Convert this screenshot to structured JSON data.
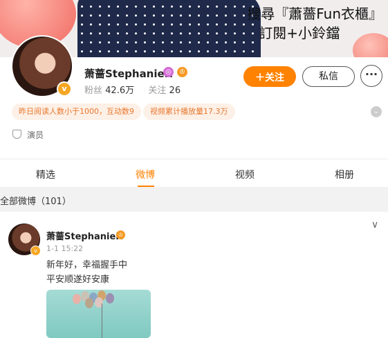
{
  "banner": {
    "line1": "搜尋『蕭薔Fun衣櫃』",
    "line2": "訂閱+小鈴鐺"
  },
  "profile": {
    "name": "萧蔷StephanieH",
    "fans_label": "粉丝",
    "fans_value": "42.6万",
    "following_label": "关注",
    "following_value": "26",
    "verified_mark": "v",
    "tag": "演员"
  },
  "buttons": {
    "follow": "＋关注",
    "message": "私信",
    "more": "···"
  },
  "chips": [
    "昨日阅读人数小于1000，互动数9",
    "视频累计播放量17.3万"
  ],
  "tabs": [
    {
      "label": "精选",
      "active": false
    },
    {
      "label": "微博",
      "active": true
    },
    {
      "label": "视频",
      "active": false
    },
    {
      "label": "相册",
      "active": false
    }
  ],
  "section": {
    "title": "全部微博（101）"
  },
  "post": {
    "author": "萧蔷StephanieH",
    "time": "1-1 15:22",
    "line1": "新年好，幸福握手中",
    "line2": "平安顺遂好安康"
  },
  "colors": {
    "accent": "#ff8200",
    "chip_bg": "#fdf0e6",
    "chip_text": "#e8772e"
  }
}
